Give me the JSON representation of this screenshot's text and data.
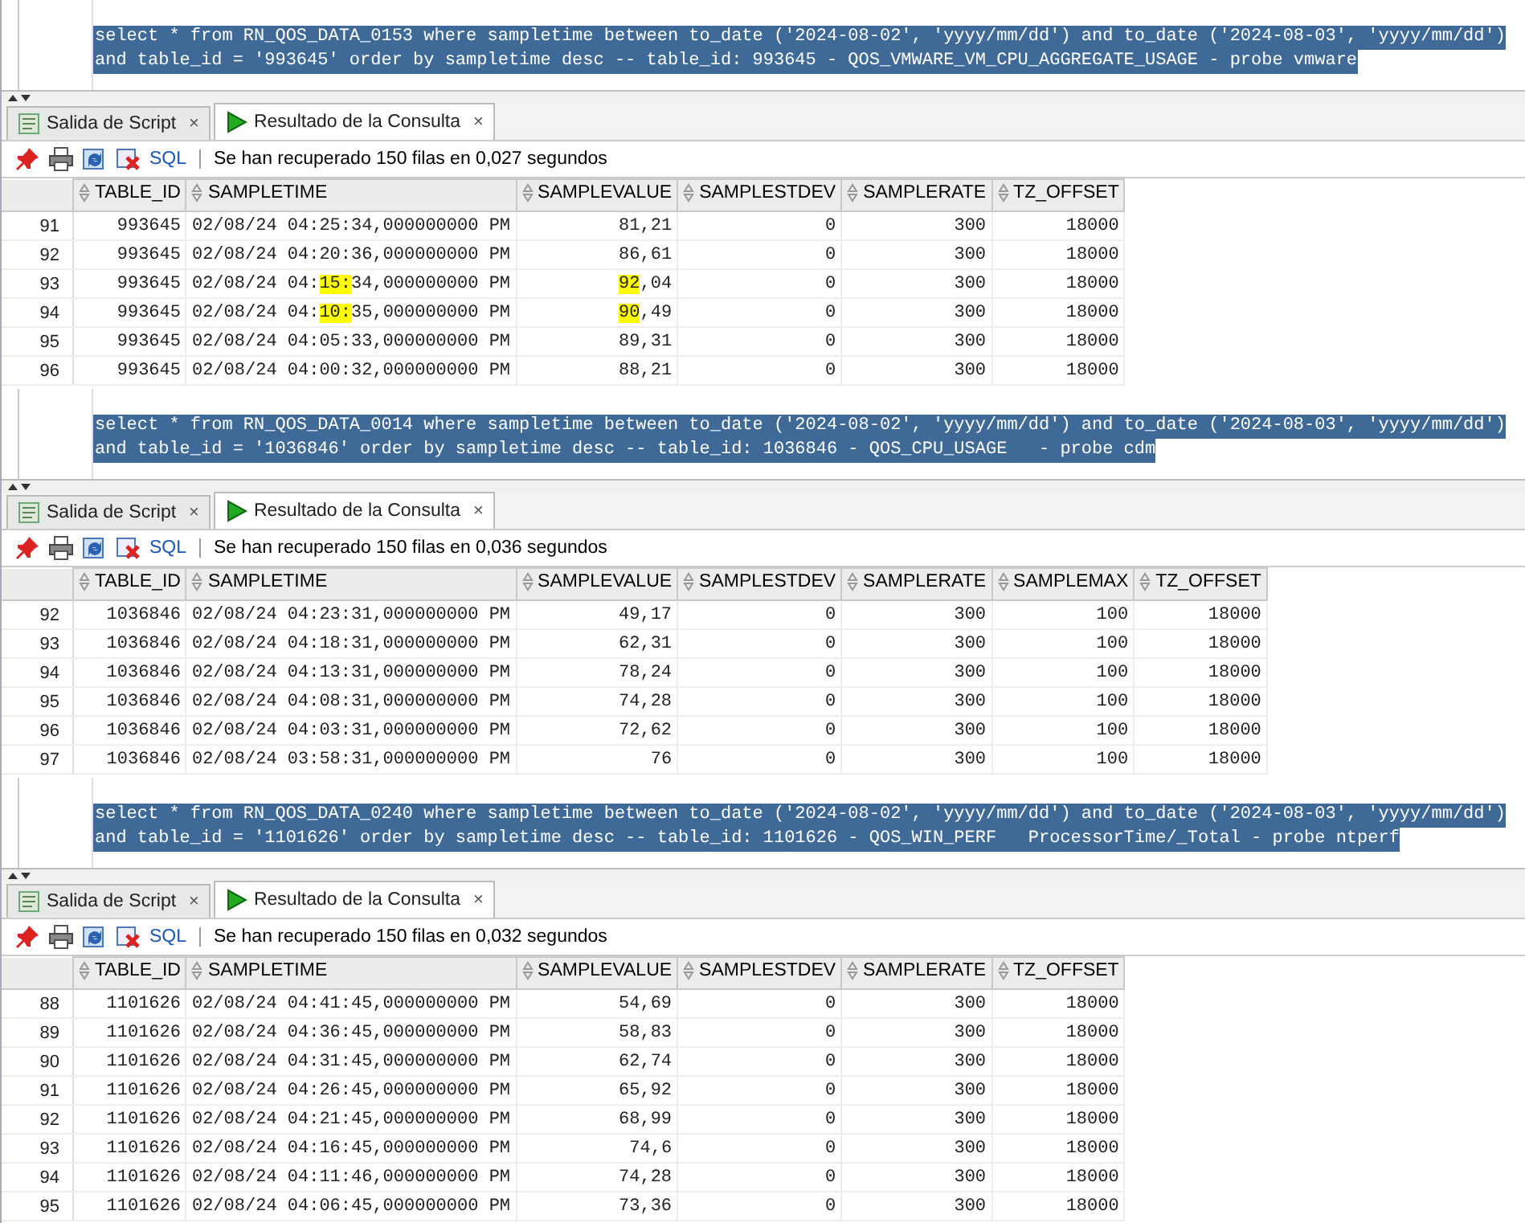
{
  "panels": [
    {
      "editor": {
        "selected": true,
        "lines": [
          "select * from RN_QOS_DATA_0153 where sampletime between to_date ('2024-08-02', 'yyyy/mm/dd') and to_date ('2024-08-03', 'yyyy/mm/dd')",
          "and table_id = '993645' order by sampletime desc -- table_id: 993645 - QOS_VMWARE_VM_CPU_AGGREGATE_USAGE - probe vmware"
        ]
      },
      "tabs": [
        {
          "label": "Salida de Script",
          "kind": "script",
          "selected": false,
          "close": "×"
        },
        {
          "label": "Resultado de la Consulta",
          "kind": "result",
          "selected": true,
          "close": "×"
        }
      ],
      "toolbar": {
        "sql_link": "SQL",
        "status": "Se han recuperado 150 filas en 0,027 segundos"
      },
      "table": {
        "columns": [
          "TABLE_ID",
          "SAMPLETIME",
          "SAMPLEVALUE",
          "SAMPLESTDEV",
          "SAMPLERATE",
          "TZ_OFFSET"
        ],
        "rows": [
          {
            "number": "91",
            "cells": [
              "993645",
              "02/08/24 04:25:34,000000000 PM",
              "81,21",
              "0",
              "300",
              "18000"
            ]
          },
          {
            "number": "92",
            "cells": [
              "993645",
              "02/08/24 04:20:36,000000000 PM",
              "86,61",
              "0",
              "300",
              "18000"
            ]
          },
          {
            "number": "93",
            "cells": [
              "993645",
              [
                {
                  "text": "02/08/24 04:",
                  "highlighted": false
                },
                {
                  "text": "15:",
                  "highlighted": true
                },
                {
                  "text": "34,000000000 PM",
                  "highlighted": false
                }
              ],
              [
                {
                  "text": "92",
                  "highlighted": true
                },
                {
                  "text": ",04",
                  "highlighted": false
                }
              ],
              "0",
              "300",
              "18000"
            ]
          },
          {
            "number": "94",
            "cells": [
              "993645",
              [
                {
                  "text": "02/08/24 04:",
                  "highlighted": false
                },
                {
                  "text": "10:",
                  "highlighted": true
                },
                {
                  "text": "35,000000000 PM",
                  "highlighted": false
                }
              ],
              [
                {
                  "text": "90",
                  "highlighted": true
                },
                {
                  "text": ",49",
                  "highlighted": false
                }
              ],
              "0",
              "300",
              "18000"
            ]
          },
          {
            "number": "95",
            "cells": [
              "993645",
              "02/08/24 04:05:33,000000000 PM",
              "89,31",
              "0",
              "300",
              "18000"
            ]
          },
          {
            "number": "96",
            "cells": [
              "993645",
              "02/08/24 04:00:32,000000000 PM",
              "88,21",
              "0",
              "300",
              "18000"
            ]
          }
        ]
      }
    },
    {
      "editor": {
        "selected": true,
        "lines": [
          "select * from RN_QOS_DATA_0014 where sampletime between to_date ('2024-08-02', 'yyyy/mm/dd') and to_date ('2024-08-03', 'yyyy/mm/dd')",
          "and table_id = '1036846' order by sampletime desc -- table_id: 1036846 - QOS_CPU_USAGE   - probe cdm"
        ]
      },
      "tabs": [
        {
          "label": "Salida de Script",
          "kind": "script",
          "selected": false,
          "close": "×"
        },
        {
          "label": "Resultado de la Consulta",
          "kind": "result",
          "selected": true,
          "close": "×"
        }
      ],
      "toolbar": {
        "sql_link": "SQL",
        "status": "Se han recuperado 150 filas en 0,036 segundos"
      },
      "table": {
        "columns": [
          "TABLE_ID",
          "SAMPLETIME",
          "SAMPLEVALUE",
          "SAMPLESTDEV",
          "SAMPLERATE",
          "SAMPLEMAX",
          "TZ_OFFSET"
        ],
        "rows": [
          {
            "number": "92",
            "cells": [
              "1036846",
              "02/08/24 04:23:31,000000000 PM",
              "49,17",
              "0",
              "300",
              "100",
              "18000"
            ]
          },
          {
            "number": "93",
            "cells": [
              "1036846",
              "02/08/24 04:18:31,000000000 PM",
              "62,31",
              "0",
              "300",
              "100",
              "18000"
            ]
          },
          {
            "number": "94",
            "cells": [
              "1036846",
              "02/08/24 04:13:31,000000000 PM",
              "78,24",
              "0",
              "300",
              "100",
              "18000"
            ]
          },
          {
            "number": "95",
            "cells": [
              "1036846",
              "02/08/24 04:08:31,000000000 PM",
              "74,28",
              "0",
              "300",
              "100",
              "18000"
            ]
          },
          {
            "number": "96",
            "cells": [
              "1036846",
              "02/08/24 04:03:31,000000000 PM",
              "72,62",
              "0",
              "300",
              "100",
              "18000"
            ]
          },
          {
            "number": "97",
            "cells": [
              "1036846",
              "02/08/24 03:58:31,000000000 PM",
              "76",
              "0",
              "300",
              "100",
              "18000"
            ]
          }
        ]
      }
    },
    {
      "editor": {
        "selected": true,
        "lines": [
          "select * from RN_QOS_DATA_0240 where sampletime between to_date ('2024-08-02', 'yyyy/mm/dd') and to_date ('2024-08-03', 'yyyy/mm/dd')",
          "and table_id = '1101626' order by sampletime desc -- table_id: 1101626 - QOS_WIN_PERF   ProcessorTime/_Total - probe ntperf"
        ]
      },
      "tabs": [
        {
          "label": "Salida de Script",
          "kind": "script",
          "selected": false,
          "close": "×"
        },
        {
          "label": "Resultado de la Consulta",
          "kind": "result",
          "selected": true,
          "close": "×"
        }
      ],
      "toolbar": {
        "sql_link": "SQL",
        "status": "Se han recuperado 150 filas en 0,032 segundos"
      },
      "table": {
        "columns": [
          "TABLE_ID",
          "SAMPLETIME",
          "SAMPLEVALUE",
          "SAMPLESTDEV",
          "SAMPLERATE",
          "TZ_OFFSET"
        ],
        "rows": [
          {
            "number": "88",
            "cells": [
              "1101626",
              "02/08/24 04:41:45,000000000 PM",
              "54,69",
              "0",
              "300",
              "18000"
            ]
          },
          {
            "number": "89",
            "cells": [
              "1101626",
              "02/08/24 04:36:45,000000000 PM",
              "58,83",
              "0",
              "300",
              "18000"
            ]
          },
          {
            "number": "90",
            "cells": [
              "1101626",
              "02/08/24 04:31:45,000000000 PM",
              "62,74",
              "0",
              "300",
              "18000"
            ]
          },
          {
            "number": "91",
            "cells": [
              "1101626",
              "02/08/24 04:26:45,000000000 PM",
              "65,92",
              "0",
              "300",
              "18000"
            ]
          },
          {
            "number": "92",
            "cells": [
              "1101626",
              "02/08/24 04:21:45,000000000 PM",
              "68,99",
              "0",
              "300",
              "18000"
            ]
          },
          {
            "number": "93",
            "cells": [
              "1101626",
              "02/08/24 04:16:45,000000000 PM",
              "74,6",
              "0",
              "300",
              "18000"
            ]
          },
          {
            "number": "94",
            "cells": [
              "1101626",
              "02/08/24 04:11:46,000000000 PM",
              "74,28",
              "0",
              "300",
              "18000"
            ]
          },
          {
            "number": "95",
            "cells": [
              "1101626",
              "02/08/24 04:06:45,000000000 PM",
              "73,36",
              "0",
              "300",
              "18000"
            ]
          }
        ]
      }
    }
  ]
}
